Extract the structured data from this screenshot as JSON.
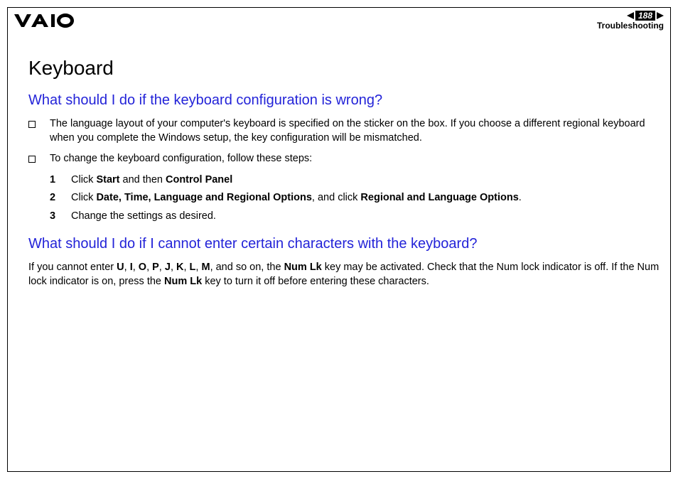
{
  "header": {
    "page_number": "188",
    "section": "Troubleshooting"
  },
  "content": {
    "title": "Keyboard",
    "q1": {
      "heading": "What should I do if the keyboard configuration is wrong?",
      "b1": "The language layout of your computer's keyboard is specified on the sticker on the box. If you choose a different regional keyboard when you complete the Windows setup, the key configuration will be mismatched.",
      "b2": "To change the keyboard configuration, follow these steps:",
      "steps": {
        "s1_pre": "Click ",
        "s1_b1": "Start",
        "s1_mid": " and then ",
        "s1_b2": "Control Panel",
        "s2_pre": "Click ",
        "s2_b1": "Date, Time, Language and Regional Options",
        "s2_mid": ", and click ",
        "s2_b2": "Regional and Language Options",
        "s2_post": ".",
        "s3": "Change the settings as desired."
      },
      "n1": "1",
      "n2": "2",
      "n3": "3"
    },
    "q2": {
      "heading": "What should I do if I cannot enter certain characters with the keyboard?",
      "p_pre": "If you cannot enter ",
      "c1": "U",
      "c2": "I",
      "c3": "O",
      "c4": "P",
      "c5": "J",
      "c6": "K",
      "c7": "L",
      "c8": "M",
      "sep": ", ",
      "p_mid1": ", and so on, the ",
      "numlk": "Num Lk",
      "p_mid2": " key may be activated. Check that the Num lock indicator is off. If the Num lock indicator is on, press the ",
      "p_post": " key to turn it off before entering these characters."
    }
  }
}
